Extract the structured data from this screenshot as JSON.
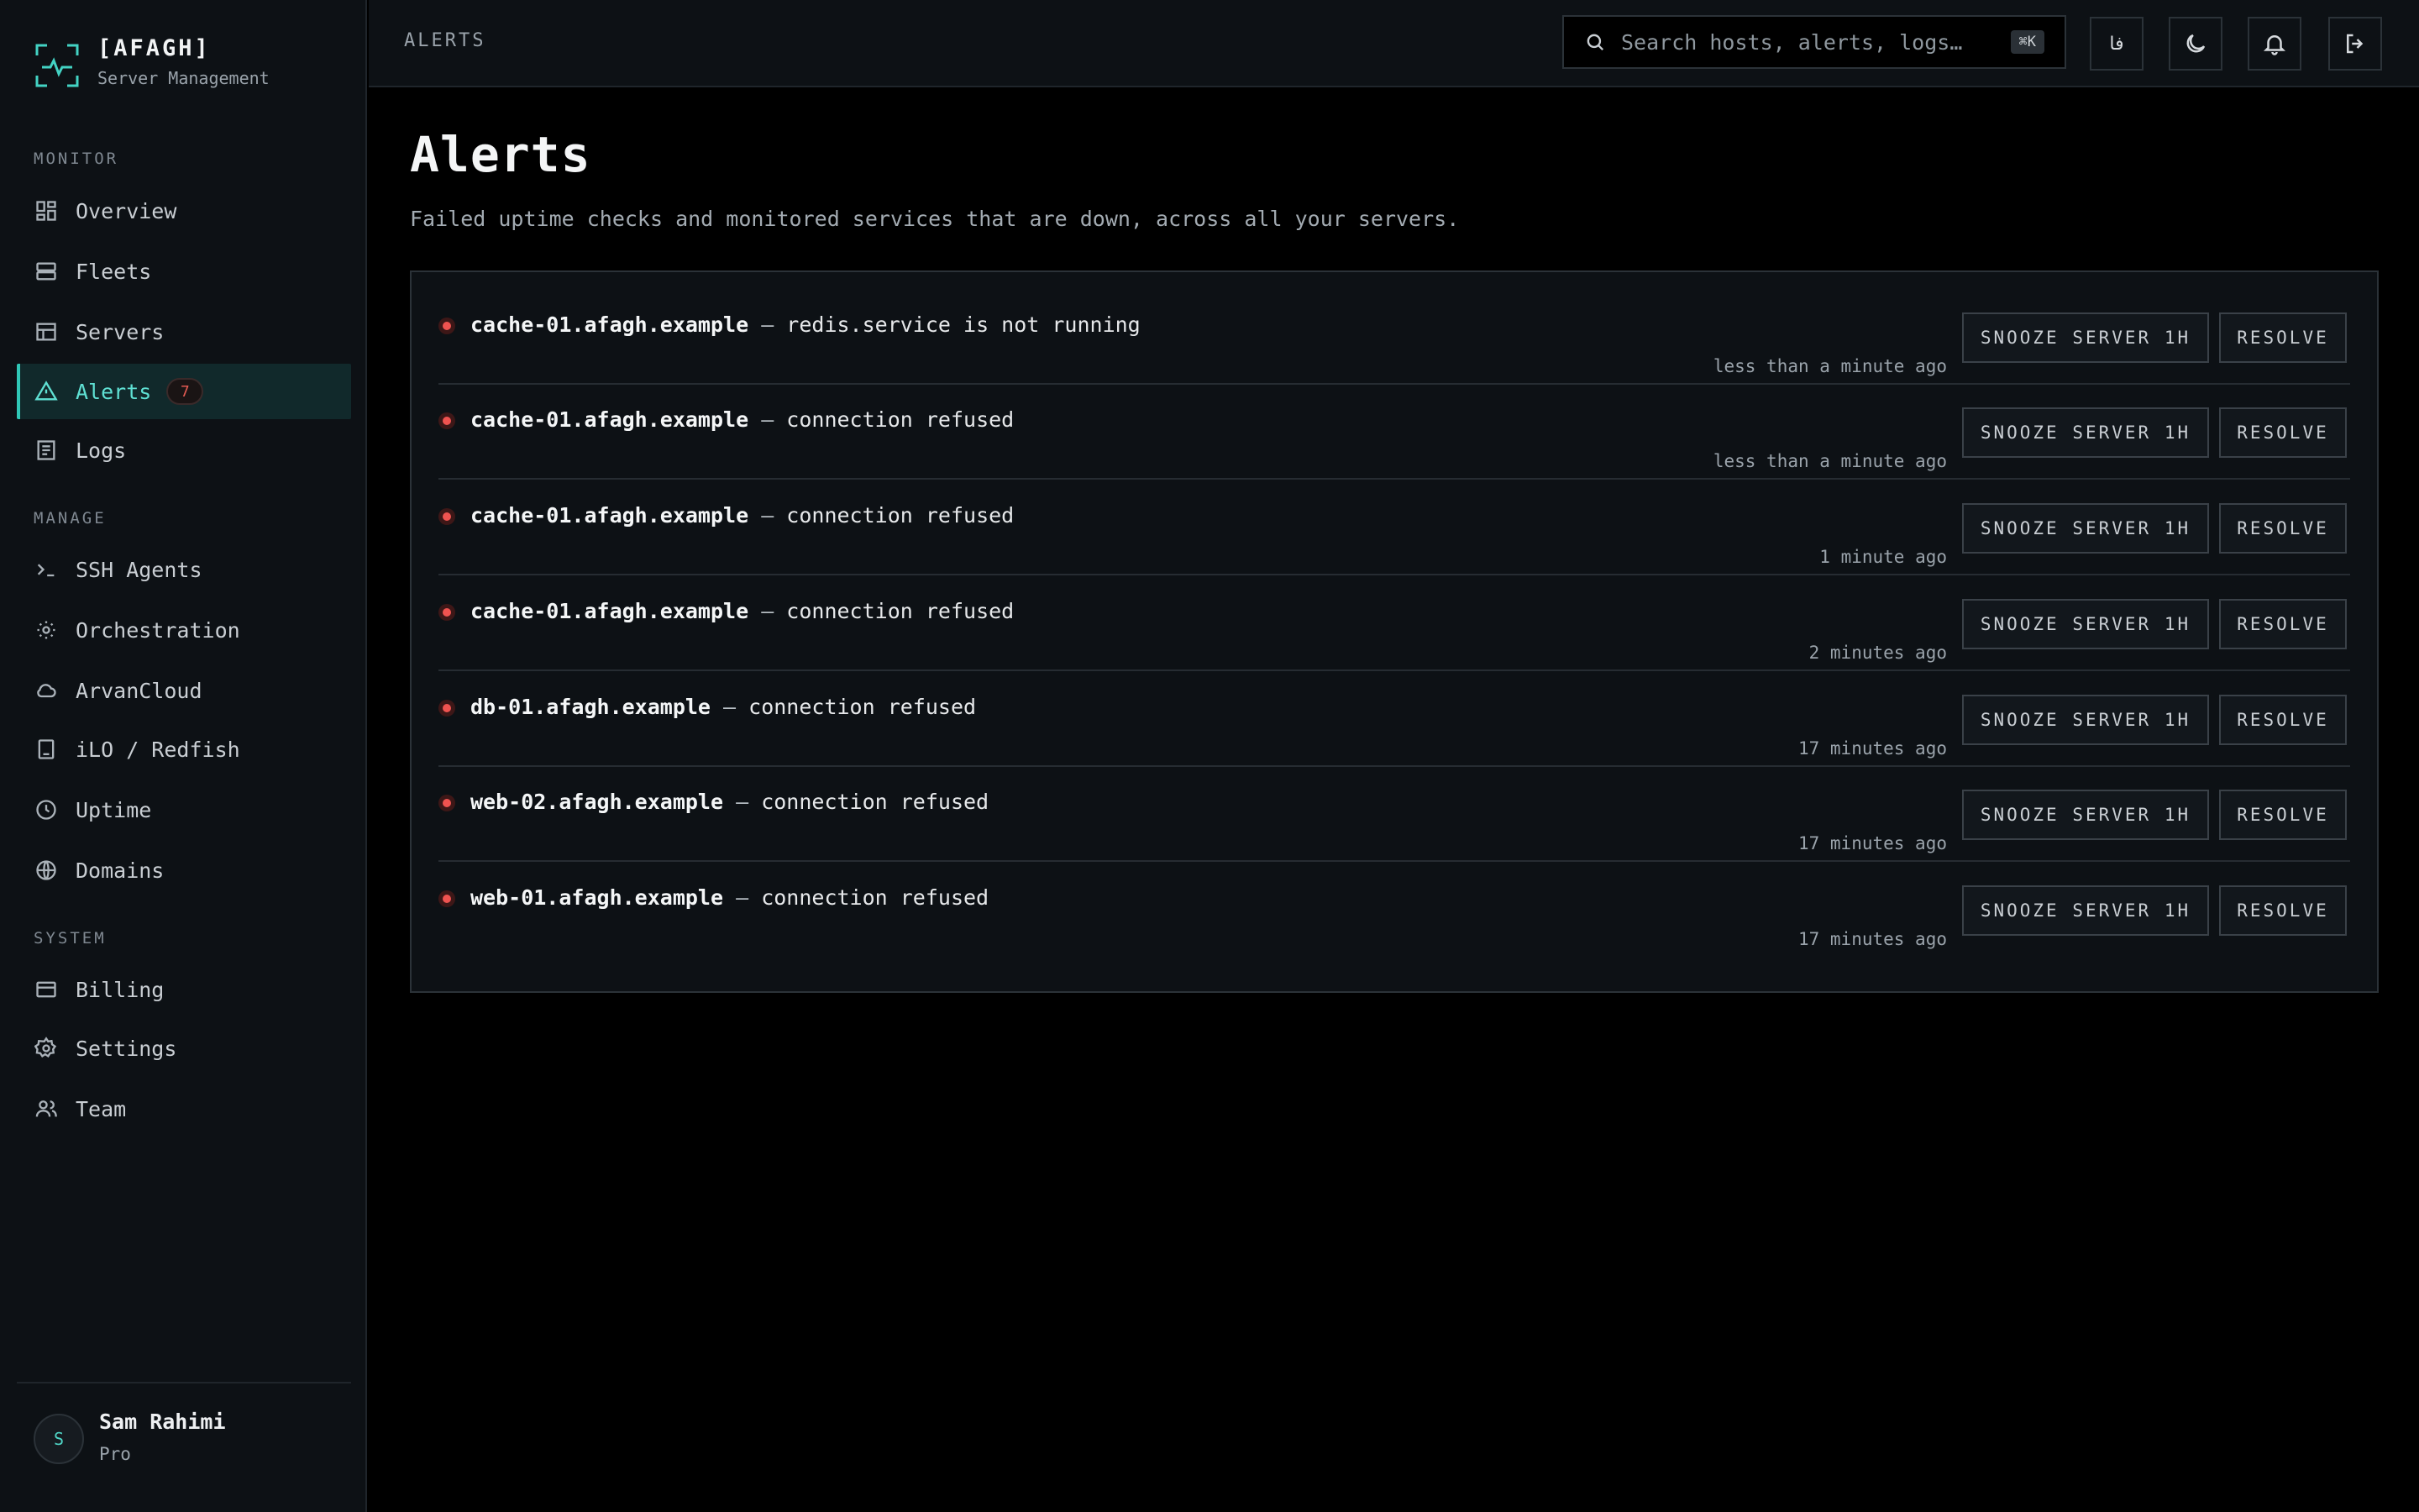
{
  "brand": {
    "name": "[AFAGH]",
    "subtitle": "Server Management"
  },
  "sidebar": {
    "sections": {
      "monitor": "MONITOR",
      "manage": "MANAGE",
      "system": "SYSTEM"
    },
    "items": {
      "overview": "Overview",
      "fleets": "Fleets",
      "servers": "Servers",
      "alerts": "Alerts",
      "alerts_badge": "7",
      "logs": "Logs",
      "ssh_agents": "SSH Agents",
      "orchestration": "Orchestration",
      "arvancloud": "ArvanCloud",
      "ilo": "iLO / Redfish",
      "uptime": "Uptime",
      "domains": "Domains",
      "billing": "Billing",
      "settings": "Settings",
      "team": "Team"
    },
    "user": {
      "initial": "S",
      "name": "Sam Rahimi",
      "plan": "Pro"
    }
  },
  "topbar": {
    "breadcrumb": "ALERTS",
    "search_placeholder": "Search hosts, alerts, logs…",
    "search_shortcut": "⌘K",
    "lang_label": "فا"
  },
  "page": {
    "title": "Alerts",
    "description": "Failed uptime checks and monitored services that are down, across all your servers."
  },
  "actions": {
    "snooze": "SNOOZE SERVER 1H",
    "resolve": "RESOLVE"
  },
  "alerts": [
    {
      "host": "cache-01.afagh.example",
      "sep": " — ",
      "message": "redis.service is not running",
      "time": "less than a minute ago"
    },
    {
      "host": "cache-01.afagh.example",
      "sep": " — ",
      "message": "connection refused",
      "time": "less than a minute ago"
    },
    {
      "host": "cache-01.afagh.example",
      "sep": " — ",
      "message": "connection refused",
      "time": "1 minute ago"
    },
    {
      "host": "cache-01.afagh.example",
      "sep": " — ",
      "message": "connection refused",
      "time": "2 minutes ago"
    },
    {
      "host": "db-01.afagh.example",
      "sep": " — ",
      "message": "connection refused",
      "time": "17 minutes ago"
    },
    {
      "host": "web-02.afagh.example",
      "sep": " — ",
      "message": "connection refused",
      "time": "17 minutes ago"
    },
    {
      "host": "web-01.afagh.example",
      "sep": " — ",
      "message": "connection refused",
      "time": "17 minutes ago"
    }
  ],
  "colors": {
    "accent": "#2fc7b6",
    "alert": "#ef5350",
    "background": "#000000",
    "panel": "#0d1115"
  }
}
